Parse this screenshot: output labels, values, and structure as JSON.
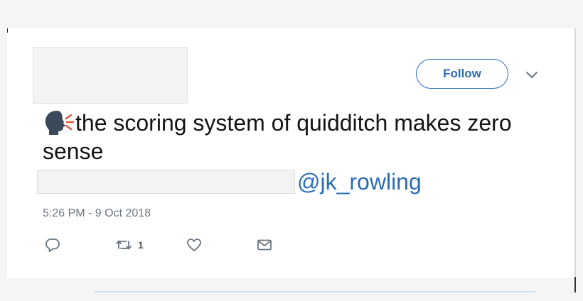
{
  "tweet": {
    "follow_label": "Follow",
    "text": "the scoring system of quidditch makes zero sense",
    "mention": "@jk_rowling",
    "timestamp": "5:26 PM - 9 Oct 2018",
    "retweet_count": "1"
  },
  "icons": {
    "speaking_head": "speaking-head-emoji",
    "chevron": "chevron-down-icon",
    "reply": "reply-icon",
    "retweet": "retweet-icon",
    "like": "heart-icon",
    "dm": "envelope-icon"
  },
  "colors": {
    "link_blue": "#2b6db6",
    "text": "#141414",
    "muted": "#6b7680",
    "icon_gray": "#6b7680"
  }
}
